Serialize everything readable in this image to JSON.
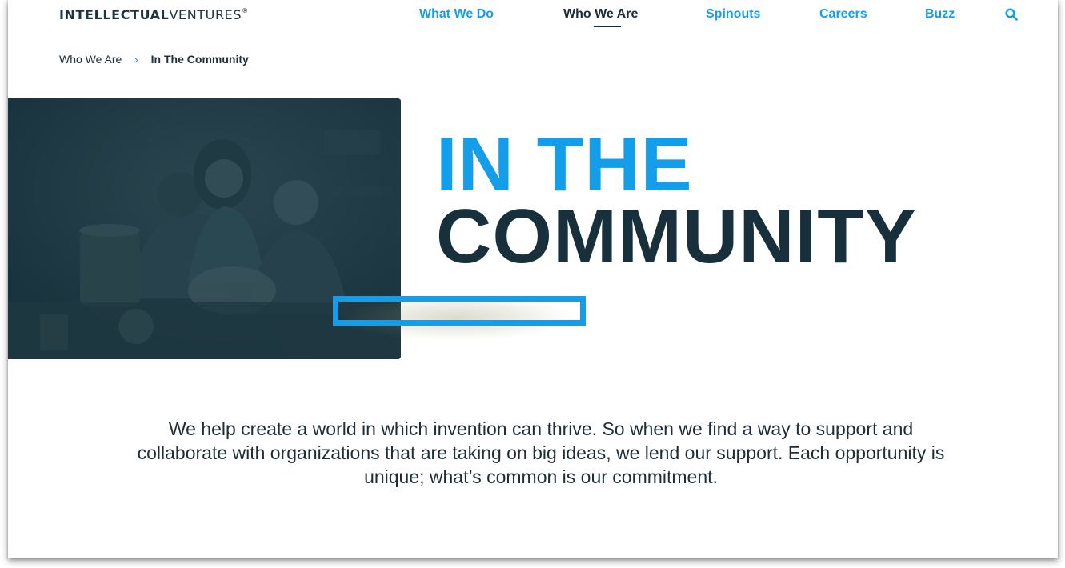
{
  "header": {
    "logo_bold": "INTELLECTUAL",
    "logo_light": "VENTURES",
    "logo_mark": "®",
    "nav": [
      {
        "label": "What We Do",
        "active": false
      },
      {
        "label": "Who We Are",
        "active": true
      },
      {
        "label": "Spinouts",
        "active": false
      },
      {
        "label": "Careers",
        "active": false
      },
      {
        "label": "Buzz",
        "active": false
      }
    ],
    "search_icon": "search-icon"
  },
  "breadcrumb": {
    "parent": "Who We Are",
    "separator": "›",
    "current": "In The Community"
  },
  "hero": {
    "title_line_1": "IN THE",
    "title_line_2": "COMMUNITY"
  },
  "intro": {
    "text": "We help create a world in which invention can thrive. So when we find a way to support and collaborate with organizations that are taking on big ideas, we lend our support. Each opportunity is unique; what’s common is our commitment."
  },
  "colors": {
    "accent": "#149ee9",
    "dark": "#17303c",
    "hero_overlay": "#1c3440"
  }
}
